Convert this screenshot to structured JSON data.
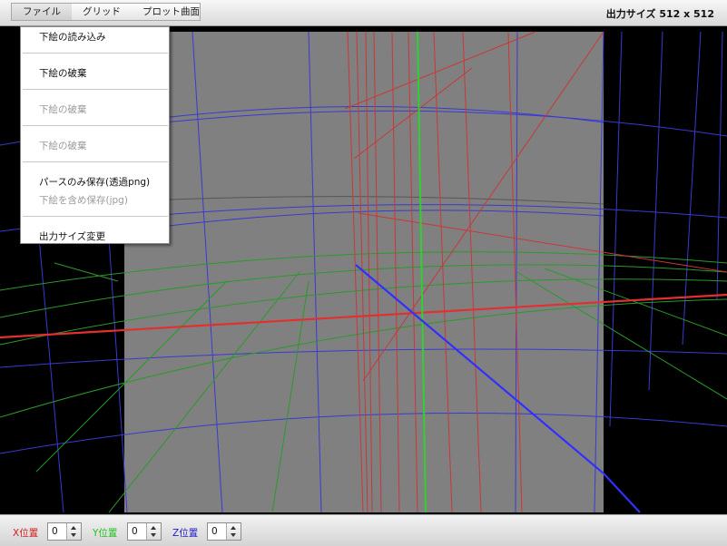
{
  "menubar": {
    "items": [
      {
        "label": "ファイル"
      },
      {
        "label": "グリッド"
      },
      {
        "label": "プロット曲面"
      }
    ]
  },
  "output_size": {
    "label": "出力サイズ",
    "value": "512 x 512"
  },
  "file_menu": {
    "items": [
      {
        "label": "下絵の読み込み",
        "enabled": true
      },
      {
        "label": "下絵の破棄",
        "enabled": true
      },
      {
        "label": "下絵の破棄",
        "enabled": false
      },
      {
        "label": "下絵の破棄",
        "enabled": false
      },
      {
        "label": "パースのみ保存(透過png)",
        "enabled": true
      },
      {
        "label": "下絵を含め保存(jpg)",
        "enabled": false
      },
      {
        "label": "出力サイズ変更",
        "enabled": true
      }
    ]
  },
  "position_controls": [
    {
      "label": "X位置",
      "value": "0",
      "color": "#d21f1f"
    },
    {
      "label": "Y位置",
      "value": "0",
      "color": "#1fc21f"
    },
    {
      "label": "Z位置",
      "value": "0",
      "color": "#2020c8"
    }
  ],
  "colors": {
    "x_axis": "#e03030",
    "y_axis": "#30d030",
    "z_axis": "#3030ff",
    "canvas": "#808080",
    "background": "#000000"
  }
}
